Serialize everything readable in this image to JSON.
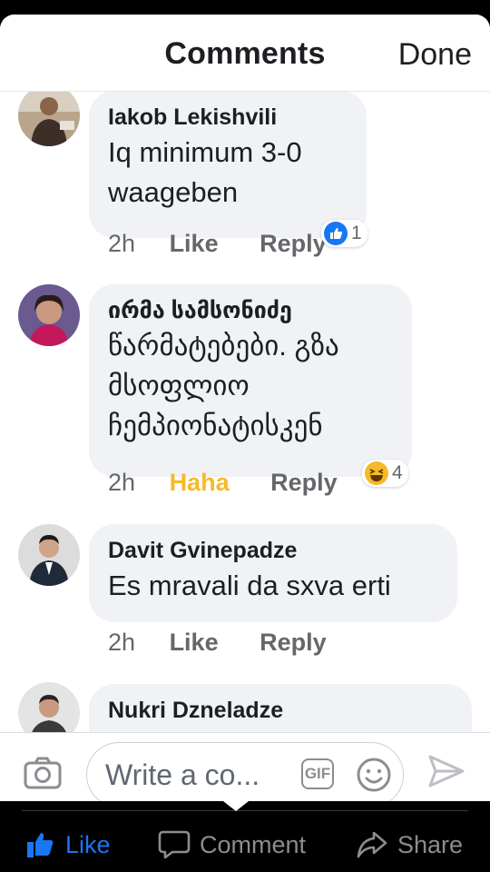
{
  "header": {
    "title": "Comments",
    "done_label": "Done"
  },
  "comments": [
    {
      "author": "Iakob Lekishvili",
      "text": "Iq minimum 3-0 waageben",
      "time": "2h",
      "like_label": "Like",
      "reply_label": "Reply",
      "reaction_icon": "like-reaction-icon",
      "reaction_count": "1"
    },
    {
      "author": "ირმა სამსონიძე",
      "text": "წარმატებები. გზა მსოფლიო ჩემპიონატისკენ",
      "time": "2h",
      "like_label": "Haha",
      "reply_label": "Reply",
      "reaction_icon": "haha-reaction-icon",
      "reaction_count": "4"
    },
    {
      "author": "Davit Gvinepadze",
      "text": "Es mravali da sxva erti",
      "time": "2h",
      "like_label": "Like",
      "reply_label": "Reply"
    },
    {
      "author": "Nukri Dzneladze"
    }
  ],
  "composer": {
    "placeholder": "Write a co...",
    "gif_label": "GIF"
  },
  "tabbar": {
    "like_label": "Like",
    "comment_label": "Comment",
    "share_label": "Share"
  },
  "colors": {
    "accent": "#1877f2",
    "haha": "#f7b928",
    "bubble": "#f0f2f5",
    "meta": "#65676b"
  }
}
